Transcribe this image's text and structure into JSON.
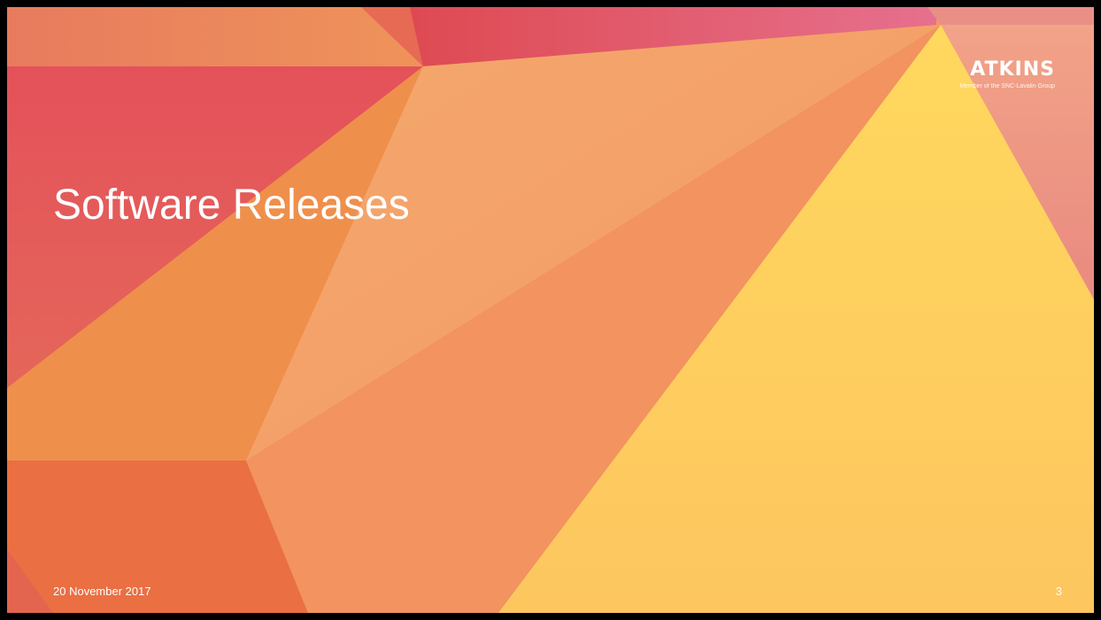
{
  "slide": {
    "title": "Software Releases",
    "date": "20 November 2017",
    "page_number": "3"
  },
  "logo": {
    "word": "ATKINS",
    "tagline": "Member of the SNC-Lavalin Group"
  },
  "colors": {
    "slide_border": "#000000",
    "title_text": "#ffffff",
    "crimson": "#e04a55",
    "coral": "#e8705a",
    "orange": "#ef8c4c",
    "peach": "#f3a46a",
    "salmon": "#f29260",
    "yellow": "#fec95c",
    "pink": "#e9907f"
  }
}
